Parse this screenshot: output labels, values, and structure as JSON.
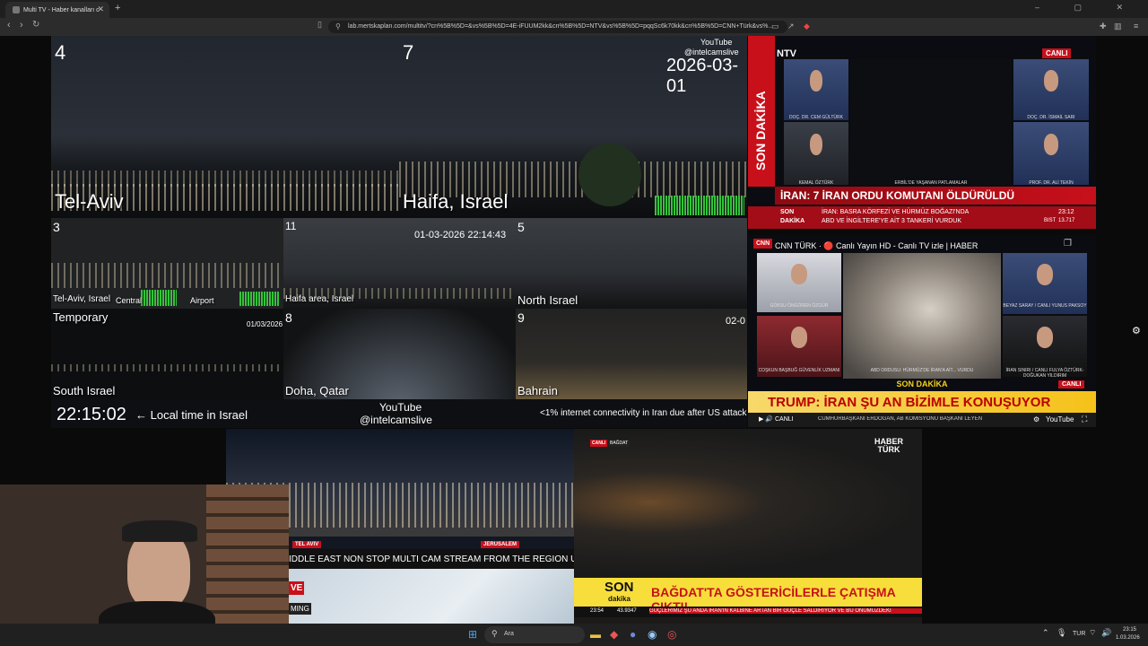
{
  "browser": {
    "tab_title": "Multi TV - Haber kanalları c",
    "new_tab": "+",
    "url": "lab.mertskaplan.com/multitv/?cn%5B%5D=&vs%5B%5D=4E-iFUUM2kk&cn%5B%5D=NTV&vs%5B%5D=pqqSc6k70kk&cn%5B%5D=CNN+Türk&vs%...",
    "window_controls": "– ▢ ✕"
  },
  "cams": {
    "c4": {
      "num": "4",
      "label": "Tel-Aviv"
    },
    "c7": {
      "num": "7",
      "label": "Haifa, Israel",
      "yt": "YouTube",
      "handle": "@intelcamslive",
      "date": "2026-03-01"
    },
    "c3": {
      "num": "3",
      "label": "Tel-Aviv, Israel",
      "central": "Central",
      "airport": "Airport"
    },
    "c11": {
      "num": "11",
      "label": "Haifa area, Israel",
      "stamp": "01-03-2026 22:14:43"
    },
    "c5": {
      "num": "5",
      "label": "North Israel"
    },
    "temp": {
      "label": "Temporary",
      "sublabel": "South Israel",
      "stamp": "01/03/2026"
    },
    "c8": {
      "num": "8",
      "label": "Doha, Qatar"
    },
    "c9": {
      "num": "9",
      "label": "Bahrain",
      "stamp": "02-0"
    }
  },
  "infostrip": {
    "time": "22:15:02",
    "note": "← Local time in Israel",
    "yt": "YouTube",
    "handle": "@intelcamslive",
    "ticker": "<1% internet connectivity in Iran due after US attack"
  },
  "ntv": {
    "logo": "NTV",
    "side": "SON DAKİKA",
    "live": "CANLI",
    "guests": [
      "DOÇ. DR. CEM GÜLTÜRK",
      "DOÇ. DR. İSMAİL SARI",
      "KEMAL ÖZTÜRK",
      "PROF. DR. ALİ TEKİN"
    ],
    "center_cap": "ERBİL'DE YAŞANAN PATLAMALAR",
    "headline": "İRAN: 7 İRAN ORDU KOMUTANI ÖLDÜRÜLDÜ",
    "son": "SON",
    "dakika": "DAKİKA",
    "sub1": "İRAN: BASRA KÖRFEZİ VE HÜRMÜZ BOĞAZI'NDA",
    "sub2": "ABD VE İNGİLTERE'YE AİT 3 TANKERİ VURDUK",
    "clock": "23:12",
    "bist": "BIST",
    "bist_val": "13.717"
  },
  "cnn": {
    "title": "CNN TÜRK · 🔴 Canlı Yayın HD - Canlı TV izle | HABER",
    "guests": [
      "GÖKSU ÖNGÖREN ÖZGÜR",
      "BEYAZ SARAY / CANLI YUNUS PAKSOY",
      "COŞKUN BAŞBUĞ GÜVENLİK UZMANI",
      "İRAN SINIRI / CANLI FULYA ÖZTÜRK-DOĞUKAN YILDIRIM"
    ],
    "center_cap": "ABD ORDUSU: HÜRMÜZ'DE İRAN'A AİT... VURDU",
    "son_dakika": "SON DAKİKA",
    "live": "CANLI",
    "headline": "TRUMP: İRAN ŞU AN BİZİMLE KONUŞUYOR",
    "ticker": "CUMHURBAŞKANI ERDOĞAN, AB KOMİSYONU BAŞKANI LEYEN",
    "player": "▶ 🔊 CANLI",
    "yt": "YouTube"
  },
  "lowerleft": {
    "tag1": "TEL AVIV",
    "tag2": "JERUSALEM",
    "ticker": "IDDLE EAST NON STOP MULTI CAM STREAM FROM THE REGION U",
    "live_letter": "VE",
    "mini": "MING"
  },
  "haberturk": {
    "logo": "HABER TÜRK",
    "live_tag": "CANLI",
    "loc_tag": "BAĞDAT",
    "son": "SON",
    "dakika": "dakika",
    "headline": "BAĞDAT'TA GÖSTERİCİLERLE ÇATIŞMA ÇIKTI!",
    "clock": "23:54",
    "value": "43.9347",
    "ticker": "GÜÇLERİMİZ ŞU ANDA İRAN'IN KALBİNE ARTAN BİR GÜÇLE SALDIRIYOR VE BU ÖNÜMÜZDEKİ"
  },
  "taskbar": {
    "search": "Ara",
    "lang": "TUR",
    "time": "23:15",
    "date": "1.03.2026"
  },
  "colors": {
    "red": "#c8101b",
    "yellow": "#f5d21a",
    "green": "#33c43a"
  }
}
